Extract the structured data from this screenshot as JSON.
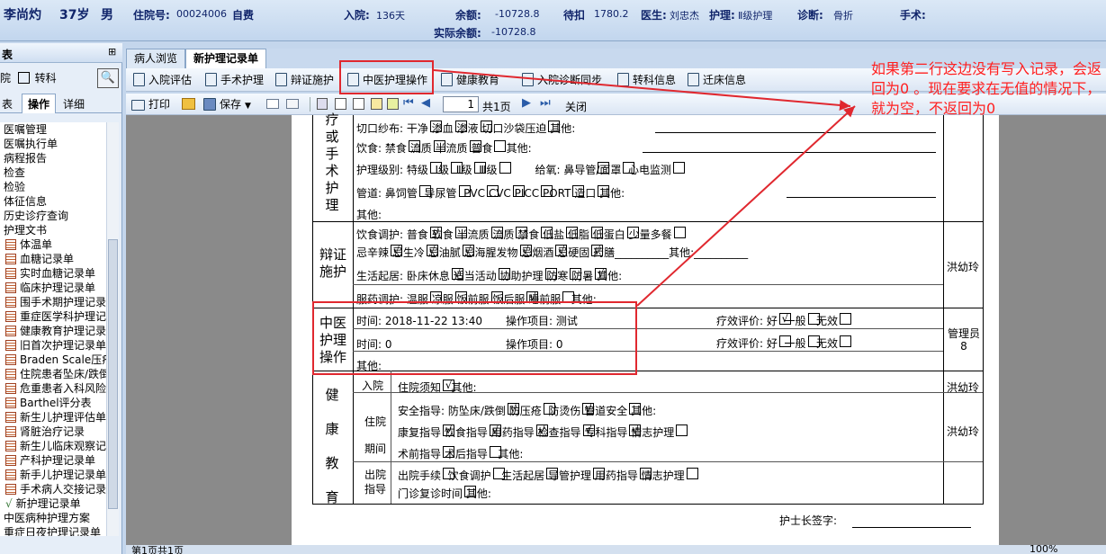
{
  "patient": {
    "name": "李尚灼",
    "age": "37岁",
    "sex": "男",
    "admission_label": "住院号:",
    "admission_no": "00024006",
    "payment_type": "自费",
    "admit_label": "入院:",
    "admit_days": "136天",
    "balance_label": "余额:",
    "balance": "-10728.8",
    "actual_balance_label": "实际余额:",
    "actual_balance": "-10728.8",
    "deduct_label": "待扣",
    "deduct": "1780.2",
    "doctor_label": "医生:",
    "doctor": "刘忠杰",
    "nursing_label": "护理:",
    "nursing": "Ⅱ级护理",
    "diagnosis_label": "诊断:",
    "diagnosis": "骨折",
    "surgery_label": "手术:"
  },
  "left": {
    "title": "表",
    "pin": "⊞",
    "filter1": "院",
    "filter2": "转科",
    "tabs": [
      "表",
      "操作",
      "详细"
    ],
    "items": [
      "医嘱管理",
      "医嘱执行单",
      "病程报告",
      "检查",
      "检验",
      "体征信息",
      "历史诊疗查询",
      "护理文书",
      "体温单",
      "血糖记录单",
      "实时血糖记录单",
      "临床护理记录单",
      "围手术期护理记录单",
      "重症医学科护理记录单",
      "健康教育护理记录单",
      "旧首次护理记录单",
      "Braden Scale压疮",
      "住院患者坠床/跌倒",
      "危重患者入科风险",
      "Barthel评分表",
      "新生儿护理评估单",
      "肾脏治疗记录",
      "新生儿临床观察记录",
      "产科护理记录单",
      "新手儿护理记录单",
      "手术病人交接记录",
      "新护理记录单",
      "中医病种护理方案",
      "重症日夜护理记录单"
    ]
  },
  "tabs": [
    "病人浏览",
    "新护理记录单"
  ],
  "toolbar1": [
    "入院评估",
    "手术护理",
    "辩证施护",
    "中医护理操作",
    "健康教育",
    "入院诊断同步",
    "转科信息",
    "迁床信息"
  ],
  "toolbar2": {
    "print": "打印",
    "save": "保存",
    "page": "1",
    "total": "共1页",
    "close": "关闭"
  },
  "doc": {
    "surg_side": [
      "疗",
      "或",
      "手",
      "术",
      "护",
      "理"
    ],
    "r1": "切口纱布: 干净",
    "r1b": "渗血",
    "r1c": "渗液",
    "r1d": "切口沙袋压迫",
    "r1e": "其他:",
    "r2": "饮食: 禁食",
    "r2b": "流质",
    "r2c": "半流质",
    "r2d": "普食",
    "r2e": "其他:",
    "r3": "护理级别: 特级",
    "r3b": "Ⅰ级",
    "r3c": "Ⅱ级",
    "r3d": "Ⅲ级",
    "r3e": "给氧: 鼻导管",
    "r3f": "/面罩",
    "r3g": "心电监测",
    "r4": "管道: 鼻饲管",
    "r4b": "导尿管",
    "r4c": "PVC",
    "r4d": "CVC",
    "r4e": "PICC",
    "r4f": "PORT",
    "r4g": "造口",
    "r4h": "其他:",
    "r5": "其他:",
    "bz_side": "辩证施护",
    "bz_nurse": "洪幼玲",
    "b1": "饮食调护: 普食",
    "b1b": "软食",
    "b1c": "半流质",
    "b1d": "流质",
    "b1e": "禁食",
    "b1f": "低盐",
    "b1g": "低脂",
    "b1h": "低蛋白",
    "b1i": "少量多餐",
    "b2": "忌辛辣",
    "b2b": "忌生冷",
    "b2c": "忌油腻",
    "b2d": "忌海腥发物",
    "b2e": "忌烟酒",
    "b2f": "忌硬固",
    "b2g": "药膳",
    "b2h": "其他:",
    "b3": "生活起居: 卧床休息",
    "b3b": "适当活动",
    "b3c": "协助护理",
    "b3d": "防寒",
    "b3e": "防暑",
    "b3f": "其他:",
    "b4": "服药调护: 温服",
    "b4b": "凉服",
    "b4c": "饭前服",
    "b4d": "饭后服",
    "b4e": "睡前服",
    "b4f": "其他:",
    "zy_side": "中医护理操作",
    "zy_nurse": "管理员8",
    "z1_time": "时间: 2018-11-22 13:40",
    "z1_op": "操作项目: 测试",
    "z1_eval": "疗效评价: 好",
    "z_mid": "一般",
    "z_bad": "无效",
    "z2_time": "时间: 0",
    "z2_op": "操作项目: 0",
    "z2_eval": "疗效评价: 好",
    "z3": "其他:",
    "jk_side": [
      "健",
      "康",
      "教",
      "育"
    ],
    "in_label": "入院",
    "in1": "住院须知",
    "in2": "其他:",
    "in_nurse": "洪幼玲",
    "mid_label": "住院期间",
    "m1": "安全指导: 防坠床/跌倒",
    "m1b": "防压疮",
    "m1c": "防烫伤",
    "m1d": "管道安全",
    "m1e": "其他:",
    "m_nurse": "洪幼玲",
    "m2": "康复指导",
    "m2b": "饮食指导",
    "m2c": "用药指导",
    "m2d": "检查指导",
    "m2e": "专科指导",
    "m2f": "情志护理",
    "m3": "术前指导",
    "m3b": "术后指导",
    "m3c": "其他:",
    "out_label": "出院指导",
    "o1": "出院手续",
    "o1b": "饮食调护",
    "o1c": "生活起居",
    "o1d": "导管护理",
    "o1e": "用药指导",
    "o1f": "情志护理",
    "o2": "门诊复诊时间",
    "o2b": "其他:",
    "sign": "护士长签字:"
  },
  "status": {
    "page": "第1页共1页",
    "zoom": "100%"
  },
  "annotation": "如果第二行这边没有写入记录，会返回为0 。现在要求在无值的情况下，就为空，不返回为0",
  "checkmark": "√"
}
